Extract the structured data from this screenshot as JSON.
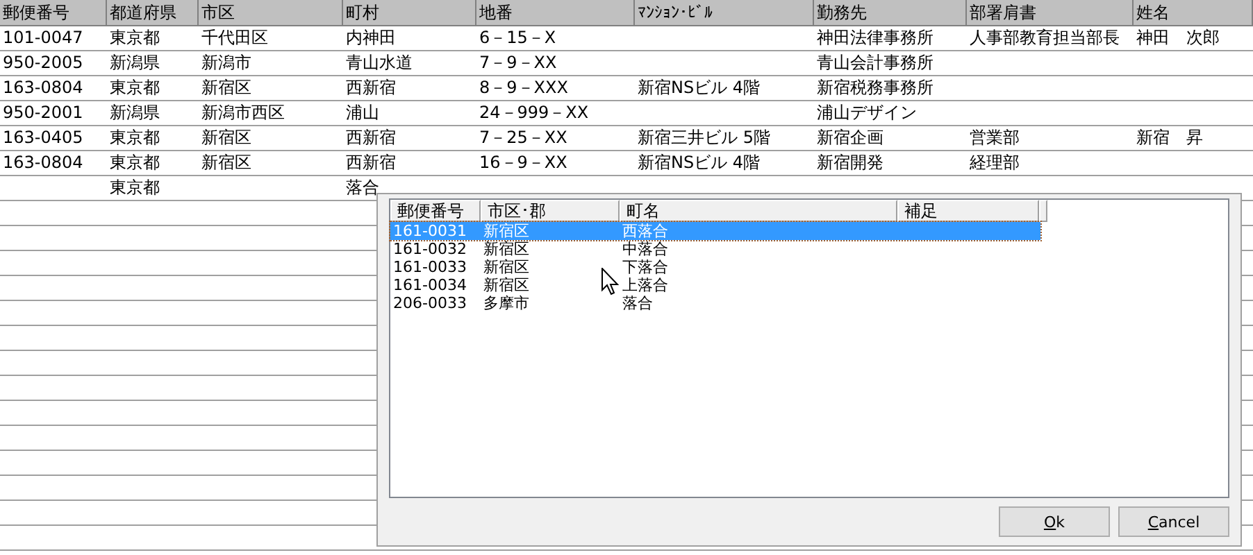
{
  "sheet": {
    "columns": [
      "郵便番号",
      "都道府県",
      "市区",
      "町村",
      "地番",
      "ﾏﾝｼｮﾝ･ﾋﾞﾙ",
      "勤務先",
      "部署肩書",
      "姓名"
    ],
    "rows": [
      [
        "101-0047",
        "東京都",
        "千代田区",
        "内神田",
        "6－15－X",
        "",
        "神田法律事務所",
        "人事部教育担当部長",
        "神田　次郎"
      ],
      [
        "950-2005",
        "新潟県",
        "新潟市",
        "青山水道",
        "7－9－XX",
        "",
        "青山会計事務所",
        "",
        ""
      ],
      [
        "163-0804",
        "東京都",
        "新宿区",
        "西新宿",
        "8－9－XXX",
        "新宿NSビル 4階",
        "新宿税務事務所",
        "",
        ""
      ],
      [
        "950-2001",
        "新潟県",
        "新潟市西区",
        "浦山",
        "24－999－XX",
        "",
        "浦山デザイン",
        "",
        ""
      ],
      [
        "163-0405",
        "東京都",
        "新宿区",
        "西新宿",
        "7－25－XX",
        "新宿三井ビル 5階",
        "新宿企画",
        "営業部",
        "新宿　昇"
      ],
      [
        "163-0804",
        "東京都",
        "新宿区",
        "西新宿",
        "16－9－XX",
        "新宿NSビル 4階",
        "新宿開発",
        "経理部",
        ""
      ],
      [
        "",
        "東京都",
        "",
        "落合",
        "",
        "",
        "",
        "",
        ""
      ]
    ]
  },
  "lookup": {
    "columns": [
      "郵便番号",
      "市区･郡",
      "町名",
      "補足"
    ],
    "rows": [
      {
        "cells": [
          "161-0031",
          "新宿区",
          "西落合",
          ""
        ],
        "selected": true
      },
      {
        "cells": [
          "161-0032",
          "新宿区",
          "中落合",
          ""
        ],
        "selected": false
      },
      {
        "cells": [
          "161-0033",
          "新宿区",
          "下落合",
          ""
        ],
        "selected": false
      },
      {
        "cells": [
          "161-0034",
          "新宿区",
          "上落合",
          ""
        ],
        "selected": false
      },
      {
        "cells": [
          "206-0033",
          "多摩市",
          "落合",
          ""
        ],
        "selected": false
      }
    ],
    "buttons": [
      "Ok",
      "Cancel"
    ]
  }
}
